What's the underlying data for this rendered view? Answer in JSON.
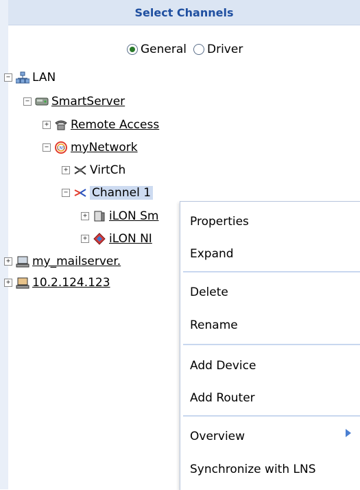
{
  "panel": {
    "title": "Select Channels"
  },
  "mode": {
    "options": [
      "General",
      "Driver"
    ],
    "selected": "General"
  },
  "tree": {
    "lan": {
      "label": "LAN",
      "toggle": "−"
    },
    "smartserver": {
      "label": "SmartServer",
      "toggle": "−"
    },
    "remote_access": {
      "label": "Remote Access",
      "toggle": "+"
    },
    "mynetwork": {
      "label": "myNetwork",
      "toggle": "−"
    },
    "virtch": {
      "label": "VirtCh",
      "toggle": "+"
    },
    "channel1": {
      "label": "Channel 1",
      "toggle": "−"
    },
    "ilon_sm": {
      "label": "iLON Sm",
      "toggle": "+"
    },
    "ilon_ni": {
      "label": "iLON NI",
      "toggle": "+"
    },
    "mailserver": {
      "label": "my_mailserver.",
      "toggle": "+"
    },
    "ip": {
      "label": "10.2.124.123",
      "toggle": "+"
    }
  },
  "context_menu": {
    "properties": "Properties",
    "expand": "Expand",
    "delete": "Delete",
    "rename": "Rename",
    "add_device": "Add Device",
    "add_router": "Add Router",
    "overview": "Overview",
    "synchronize": "Synchronize with LNS"
  },
  "colors": {
    "header_bg": "#dbe5f3",
    "header_text": "#1f4fa0",
    "selection": "#cddbf1",
    "menu_separator": "#c8d7ef"
  }
}
